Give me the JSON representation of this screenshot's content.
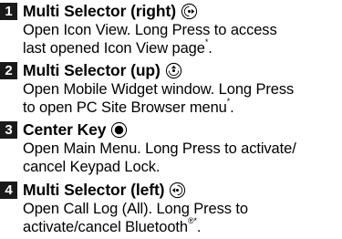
{
  "entries": [
    {
      "number": "1",
      "title": "Multi Selector (right)",
      "icon": "multi-selector-right-icon",
      "desc_line1": "Open Icon View. Long Press to access",
      "desc_line2": "last opened Icon View page",
      "desc_note": "*",
      "desc_end": "."
    },
    {
      "number": "2",
      "title": "Multi Selector (up)",
      "icon": "multi-selector-up-icon",
      "desc_line1": "Open Mobile Widget window. Long Press",
      "desc_line2": "to open PC Site Browser menu",
      "desc_note": "*",
      "desc_end": "."
    },
    {
      "number": "3",
      "title": "Center Key",
      "icon": "center-key-icon",
      "desc_line1": "Open Main Menu. Long Press to activate/",
      "desc_line2": "cancel Keypad Lock."
    },
    {
      "number": "4",
      "title": "Multi Selector (left)",
      "icon": "multi-selector-left-icon",
      "desc_line1": "Open Call Log (All). Long Press to",
      "desc_line2": "activate/cancel Bluetooth",
      "desc_reg": "®",
      "desc_note": "*",
      "desc_end": "."
    }
  ]
}
